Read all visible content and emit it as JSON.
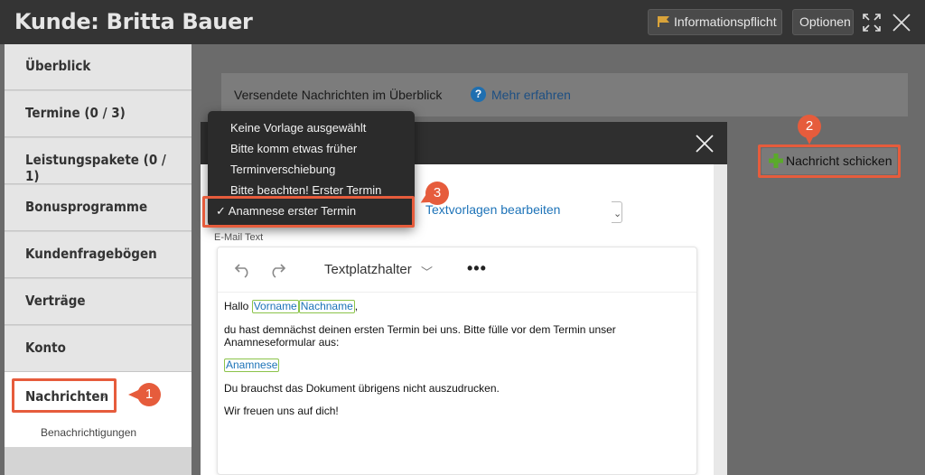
{
  "header": {
    "title": "Kunde: Britta Bauer",
    "info_button": "Informationspflicht",
    "options_button": "Optionen"
  },
  "sidebar": {
    "items": [
      {
        "label": "Überblick"
      },
      {
        "label": "Termine (0 / 3)"
      },
      {
        "label": "Leistungspakete (0 / 1)"
      },
      {
        "label": "Bonusprogramme"
      },
      {
        "label": "Kundenfragebögen"
      },
      {
        "label": "Verträge"
      },
      {
        "label": "Konto"
      },
      {
        "label": "Nachrichten"
      }
    ],
    "sub_item": "Benachrichtigungen"
  },
  "main": {
    "info_text": "Versendete Nachrichten im Überblick",
    "more_link": "Mehr erfahren",
    "send_button": "Nachricht schicken"
  },
  "modal": {
    "template_link": "Textvorlagen bearbeiten",
    "email_label": "E-Mail Text",
    "placeholder_dropdown": "Textplatzhalter",
    "content": {
      "greeting": "Hallo",
      "ph_first": "Vorname",
      "ph_last": "Nachname",
      "comma": ",",
      "line1": "du hast demnächst deinen ersten Termin bei uns. Bitte fülle vor dem Termin unser Anamneseformular aus:",
      "ph_anamnese": "Anamnese",
      "line2": "Du brauchst das Dokument übrigens nicht auszudrucken.",
      "line3": "Wir freuen uns auf dich!"
    }
  },
  "dropdown": {
    "options": [
      "Keine Vorlage ausgewählt",
      "Bitte komm etwas früher",
      "Terminverschiebung",
      "Bitte beachten! Erster Termin",
      "✓ Anamnese erster Termin"
    ],
    "selected_index": 4
  },
  "markers": [
    "1",
    "2",
    "3"
  ],
  "colors": {
    "highlight": "#e65c3c",
    "link": "#1d73b8",
    "placeholder_border": "#8bc34a",
    "plus_icon": "#5aaa2a",
    "flag_icon": "#d9a33a"
  }
}
